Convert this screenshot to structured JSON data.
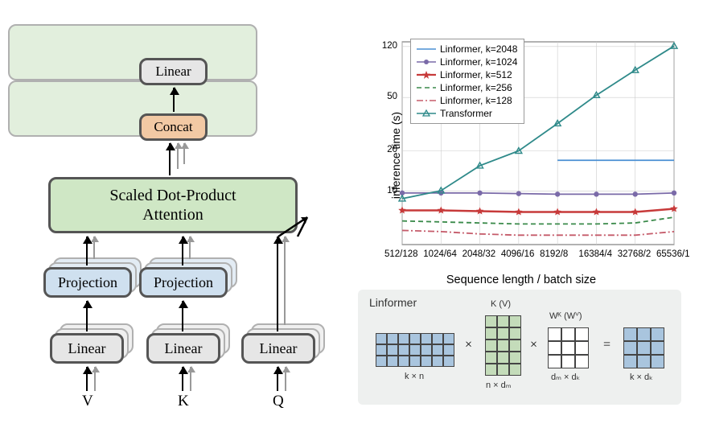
{
  "arch": {
    "top_linear": "Linear",
    "concat": "Concat",
    "attention_line1": "Scaled Dot-Product",
    "attention_line2": "Attention",
    "projection_v": "Projection",
    "projection_k": "Projection",
    "linear_v": "Linear",
    "linear_k": "Linear",
    "linear_q": "Linear",
    "input_v": "V",
    "input_k": "K",
    "input_q": "Q"
  },
  "chart_data": {
    "type": "line",
    "title": "",
    "xlabel": "Sequence length / batch size",
    "ylabel": "inference time (s)",
    "yscale": "log",
    "ylim": [
      4,
      130
    ],
    "yticks": [
      10,
      20,
      50,
      120
    ],
    "categories": [
      "512/128",
      "1024/64",
      "2048/32",
      "4096/16",
      "8192/8",
      "16384/4",
      "32768/2",
      "65536/1"
    ],
    "series": [
      {
        "name": "Linformer, k=2048",
        "color": "#4a8fd3",
        "marker": "none",
        "dash": "solid",
        "values": [
          null,
          null,
          null,
          null,
          17,
          17,
          17,
          17
        ]
      },
      {
        "name": "Linformer, k=1024",
        "color": "#7a6aa8",
        "marker": "circle",
        "dash": "solid",
        "values": [
          9.7,
          9.7,
          9.7,
          9.6,
          9.5,
          9.5,
          9.5,
          9.7
        ]
      },
      {
        "name": "Linformer, k=512",
        "color": "#c73a3a",
        "marker": "star",
        "dash": "solid",
        "values": [
          7.2,
          7.2,
          7.1,
          7.0,
          7.0,
          7.0,
          7.0,
          7.4
        ]
      },
      {
        "name": "Linformer, k=256",
        "color": "#3a8a4a",
        "marker": "none",
        "dash": "dash",
        "values": [
          6.0,
          5.9,
          5.8,
          5.7,
          5.7,
          5.7,
          5.8,
          6.4
        ]
      },
      {
        "name": "Linformer, k=128",
        "color": "#c55b6a",
        "marker": "none",
        "dash": "dashdot",
        "values": [
          5.1,
          5.0,
          4.8,
          4.7,
          4.7,
          4.7,
          4.7,
          5.0
        ]
      },
      {
        "name": "Transformer",
        "color": "#2f8a8a",
        "marker": "tri",
        "dash": "solid",
        "values": [
          8.8,
          10.1,
          15.5,
          20,
          32,
          52,
          80,
          121
        ]
      }
    ]
  },
  "matrix": {
    "panel_title": "Linformer",
    "kv_label_top": "K (V)",
    "wk_label_top": "Wᴷ (Wⱽ)",
    "k_by_n": "k × n",
    "n_by_dm": "n × dₘ",
    "dm_by_dk": "dₘ × dₖ",
    "k_by_dk": "k × dₖ",
    "times": "×",
    "equals": "="
  }
}
